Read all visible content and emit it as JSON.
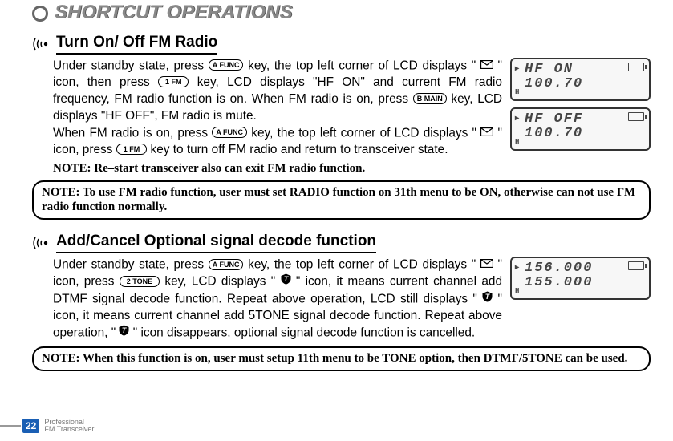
{
  "header": {
    "title": "SHORTCUT OPERATIONS"
  },
  "section1": {
    "title": "Turn On/ Off FM Radio",
    "p1a": "Under standby state, press ",
    "p1b": " key, the top left corner of LCD displays \" ",
    "p1c": "\" icon, then press ",
    "p1d": " key, LCD displays \"HF ON\" and current FM radio frequency, FM radio function is on. When FM radio is on, press ",
    "p1e": " key, LCD displays \"HF OFF\", FM radio is mute.",
    "p2a": "When FM radio is on, press ",
    "p2b": " key, the top left corner of LCD displays \" ",
    "p2c": "\" icon, press ",
    "p2d": " key to turn off FM radio and return to transceiver state.",
    "noteLine": "NOTE: Re–start transceiver also can exit FM radio function.",
    "noteBox": "NOTE: To use FM radio function, user must set RADIO function on 31th menu to be ON, otherwise can not use FM radio function normally."
  },
  "section2": {
    "title": "Add/Cancel Optional signal decode function",
    "p1a": "Under standby state, press ",
    "p1b": " key, the top left corner of LCD displays \" ",
    "p1c": "\" icon, press ",
    "p1d": " key, LCD displays \" ",
    "p1e": " \" icon, it means current channel add DTMF signal decode function. Repeat above operation, LCD still displays \" ",
    "p1f": " \" icon, it means current channel add 5TONE signal decode function. Repeat above operation, \" ",
    "p1g": " \" icon disappears, optional signal decode function is cancelled.",
    "noteBox": "NOTE: When this function is on, user must setup 11th menu to be TONE option, then DTMF/5TONE can be used."
  },
  "lcd": {
    "a1": "HF  ON",
    "a2": "100.70",
    "b1": "HF  OFF",
    "b2": "100.70",
    "c1": "156.000",
    "c2": "155.000"
  },
  "keys": {
    "func": "A FUNC",
    "fm": "1 FM",
    "main": "B MAIN",
    "tone": "2 TONE"
  },
  "footer": {
    "page": "22",
    "line1": "Professional",
    "line2": "FM Transceiver"
  }
}
